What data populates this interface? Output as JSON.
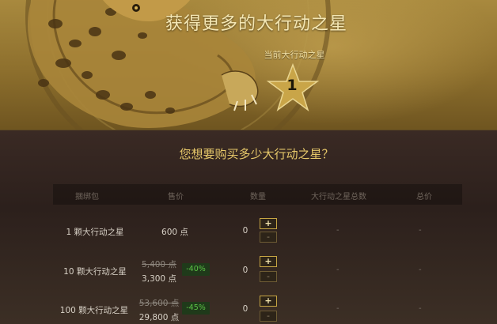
{
  "header": {
    "title": "获得更多的大行动之星",
    "current_label": "当前大行动之星",
    "current_count": "1"
  },
  "question": "您想要购买多少大行动之星？",
  "table": {
    "columns": [
      "捆绑包",
      "售价",
      "数量",
      "大行动之星总数",
      "总价"
    ],
    "rows": [
      {
        "bundle": "1 颗大行动之星",
        "old_price": "",
        "price": "600 点",
        "discount": "",
        "qty": "0",
        "total_stars": "-",
        "total_price": "-"
      },
      {
        "bundle": "10 颗大行动之星",
        "old_price": "5,400 点",
        "price": "3,300 点",
        "discount": "-40%",
        "qty": "0",
        "total_stars": "-",
        "total_price": "-"
      },
      {
        "bundle": "100 颗大行动之星",
        "old_price": "53,600 点",
        "price": "29,800 点",
        "discount": "-45%",
        "qty": "0",
        "total_stars": "-",
        "total_price": "-"
      }
    ],
    "plus_label": "+",
    "minus_label": "-"
  }
}
